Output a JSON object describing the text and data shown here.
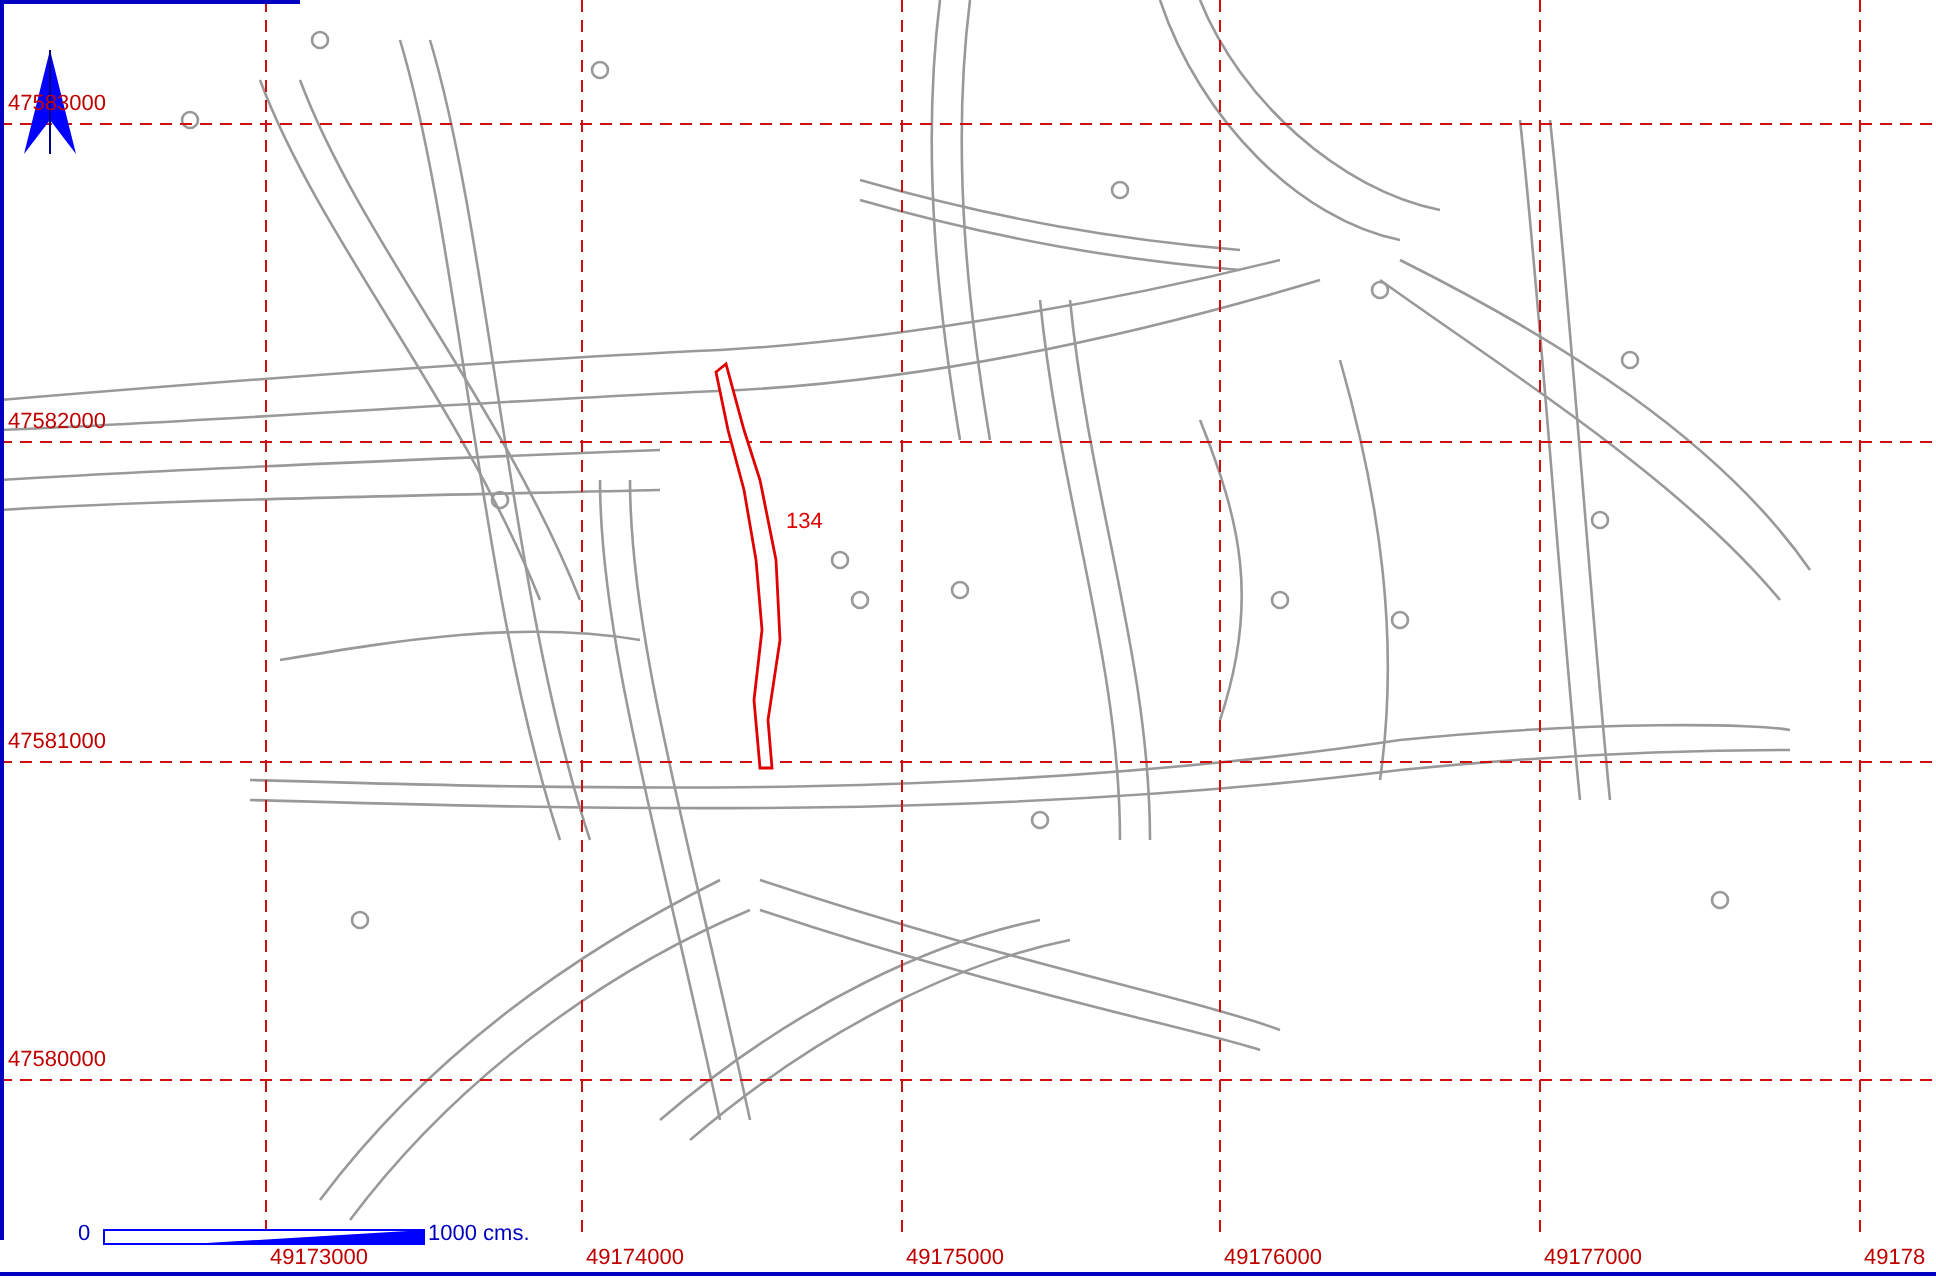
{
  "map": {
    "y_grid_labels": [
      "47583000",
      "47582000",
      "47581000",
      "47580000"
    ],
    "x_grid_labels": [
      "49173000",
      "49174000",
      "49175000",
      "49176000",
      "49177000",
      "49178"
    ],
    "feature": {
      "label": "134"
    },
    "scale_bar": {
      "start_label": "0",
      "end_label": "1000 cms."
    }
  }
}
